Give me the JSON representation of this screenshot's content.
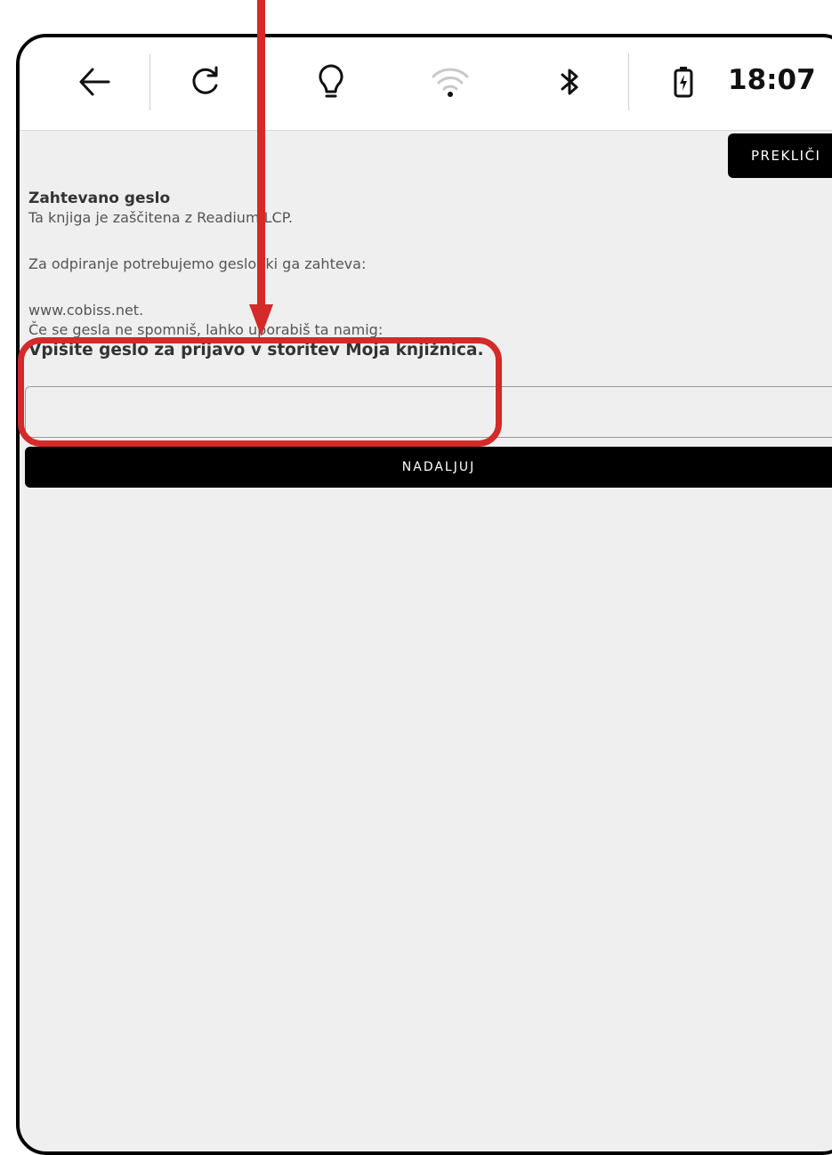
{
  "topbar": {
    "icons": [
      "back-arrow-icon",
      "refresh-icon",
      "light-bulb-icon",
      "wifi-icon",
      "bluetooth-icon",
      "battery-icon"
    ],
    "clock": "18:07"
  },
  "dialog": {
    "cancel_label": "PREKLIČI",
    "title": "Zahtevano geslo",
    "line1": "Ta knjiga je zaščitena z Readium LCP.",
    "line2": "Za odpiranje potrebujemo geslo, ki ga zahteva:",
    "line3": "www.cobiss.net.",
    "line4": "Če se gesla ne spomniš, lahko uporabiš ta namig:",
    "prompt": "Vpišite geslo za prijavo v storitev Moja knjižnica.",
    "password_value": "",
    "continue_label": "NADALJUJ"
  },
  "annotation": {
    "color": "#d42a2a"
  }
}
